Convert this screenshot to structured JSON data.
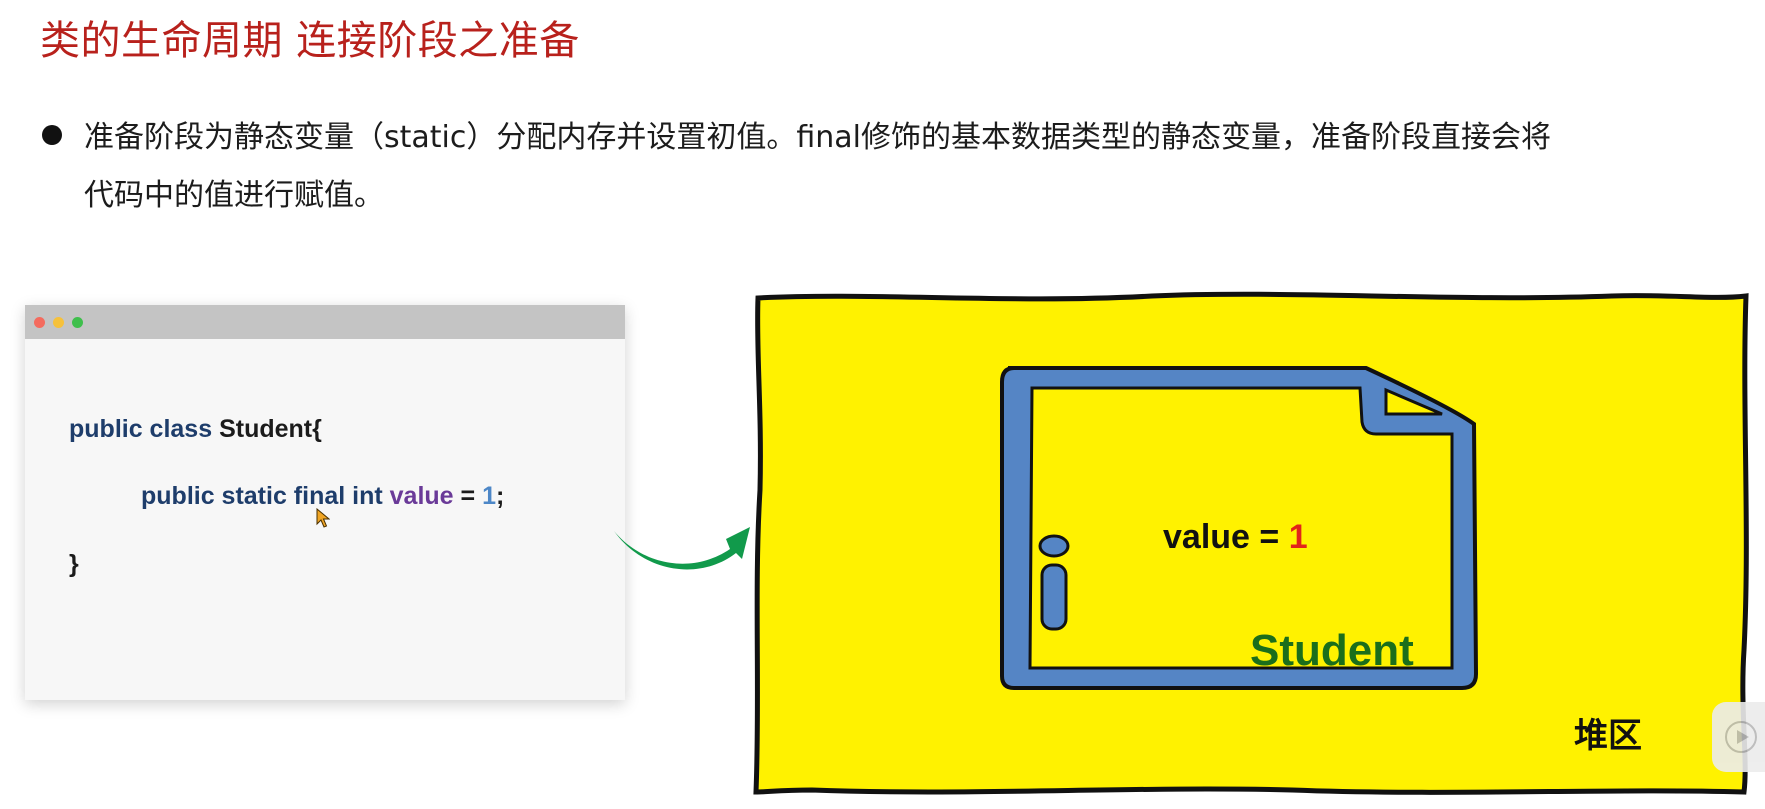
{
  "slide": {
    "title": "类的生命周期 连接阶段之准备",
    "bullet": {
      "line1": "准备阶段为静态变量（static）分配内存并设置初值。final修饰的基本数据类型的静态变量，准备阶段直接会将",
      "line2": "代码中的值进行赋值。"
    }
  },
  "code": {
    "line1": {
      "kw": "public class ",
      "cls": "Student{"
    },
    "line2": {
      "kw": "public static final int ",
      "var": "value",
      "op": " = ",
      "num": "1",
      "end": ";"
    },
    "line3": "}"
  },
  "heap": {
    "value_text": "value = ",
    "value_num": "1",
    "class_name": "Student",
    "area_label": "堆区"
  },
  "colors": {
    "title": "#b8211c",
    "heap_fill": "#fff200",
    "object_border": "#5585c5",
    "class_label": "#1b6e1b",
    "value_highlight": "#e2231a",
    "arrow": "#119a4b"
  },
  "icons": {
    "arrow": "curved-arrow-right-icon",
    "info": "info-icon",
    "cursor": "mouse-cursor-icon",
    "player": "play-icon"
  }
}
